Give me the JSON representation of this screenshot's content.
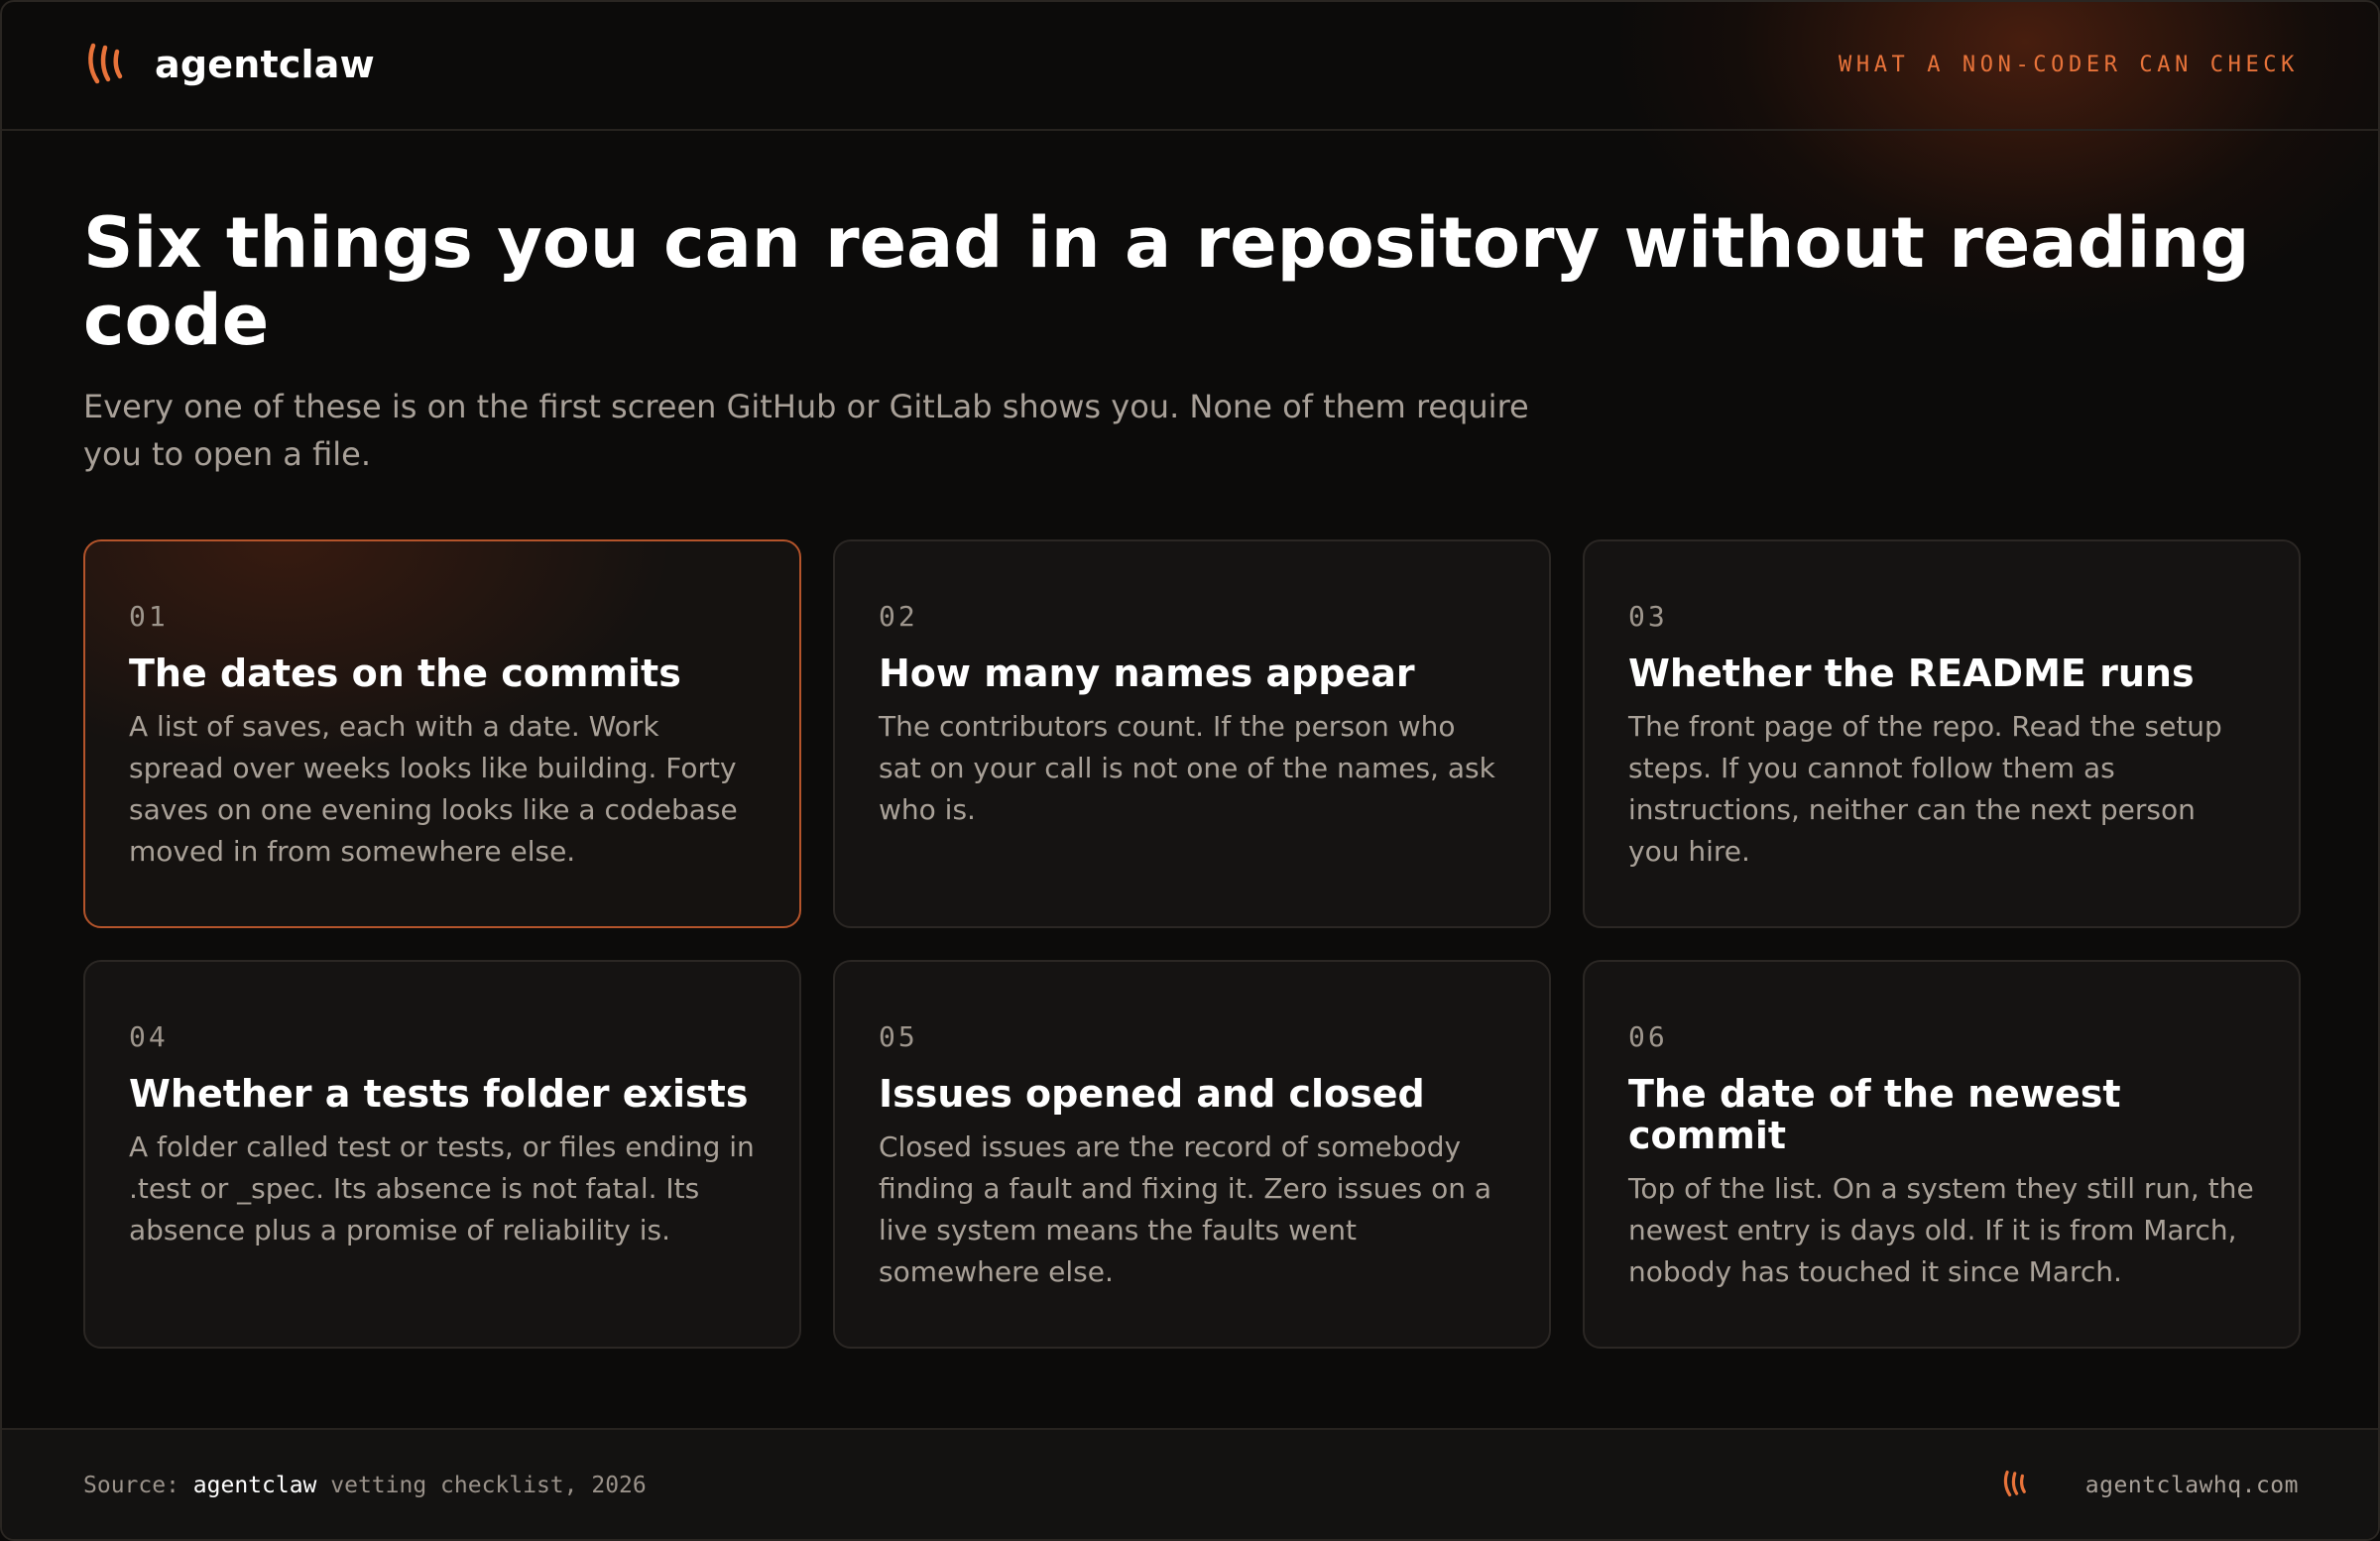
{
  "header": {
    "brand": "agentclaw",
    "logo_icon": "claw-marks-icon",
    "tag": "WHAT A NON-CODER CAN CHECK"
  },
  "hero": {
    "title": "Six things you can read in a repository without reading code",
    "subtitle": "Every one of these is on the first screen GitHub or GitLab shows you. None of them require you to open a file."
  },
  "cards": [
    {
      "number": "01",
      "title": "The dates on the commits",
      "body": "A list of saves, each with a date. Work spread over weeks looks like building. Forty saves on one evening looks like a codebase moved in from somewhere else.",
      "highlighted": true
    },
    {
      "number": "02",
      "title": "How many names appear",
      "body": "The contributors count. If the person who sat on your call is not one of the names, ask who is.",
      "highlighted": false
    },
    {
      "number": "03",
      "title": "Whether the README runs",
      "body": "The front page of the repo. Read the setup steps. If you cannot follow them as instructions, neither can the next person you hire.",
      "highlighted": false
    },
    {
      "number": "04",
      "title": "Whether a tests folder exists",
      "body": "A folder called test or tests, or files ending in .test or _spec. Its absence is not fatal. Its absence plus a promise of reliability is.",
      "highlighted": false
    },
    {
      "number": "05",
      "title": "Issues opened and closed",
      "body": "Closed issues are the record of somebody finding a fault and fixing it. Zero issues on a live system means the faults went somewhere else.",
      "highlighted": false
    },
    {
      "number": "06",
      "title": "The date of the newest commit",
      "body": "Top of the list. On a system they still run, the newest entry is days old. If it is from March, nobody has touched it since March.",
      "highlighted": false
    }
  ],
  "footer": {
    "source_prefix": "Source: ",
    "source_name": "agentclaw",
    "source_suffix": " vetting checklist, 2026",
    "site": "agentclawhq.com"
  },
  "colors": {
    "accent": "#e8733a",
    "background": "#0c0b0a",
    "card": "#151312",
    "highlight_border": "#b4542b"
  }
}
